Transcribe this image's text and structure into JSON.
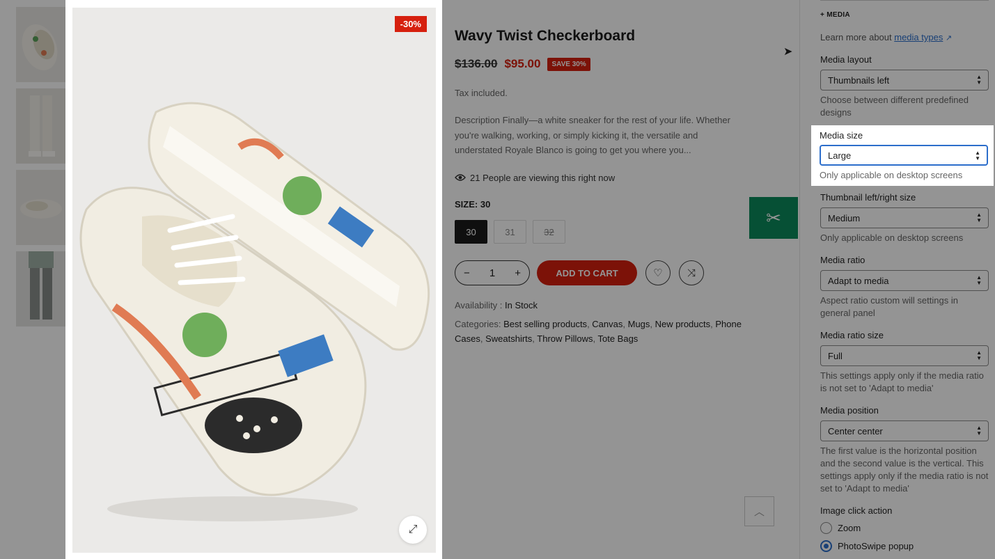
{
  "product": {
    "title": "Wavy Twist Checkerboard",
    "price_old": "$136.00",
    "price_new": "$95.00",
    "save_badge": "SAVE 30%",
    "sale_badge": "-30%",
    "tax_note": "Tax included.",
    "description": "Description Finally—a white sneaker for the rest of your life. Whether you're walking, working, or simply kicking it, the versatile and understated Royale Blanco is going to get you where you...",
    "viewing": "21 People are viewing this right now",
    "size_label": "SIZE: 30",
    "sizes": [
      "30",
      "31",
      "32"
    ],
    "quantity": "1",
    "add_to_cart": "ADD TO CART",
    "availability_label": "Availability :",
    "availability_value": "In Stock",
    "categories_label": "Categories:",
    "categories": [
      "Best selling products",
      "Canvas",
      "Mugs",
      "New products",
      "Phone Cases",
      "Sweatshirts",
      "Throw Pillows",
      "Tote Bags"
    ]
  },
  "panel": {
    "heading": "+ MEDIA",
    "learn_prefix": "Learn more about",
    "learn_link": "media types",
    "media_layout": {
      "label": "Media layout",
      "value": "Thumbnails left",
      "hint": "Choose between different predefined designs"
    },
    "media_size": {
      "label": "Media size",
      "value": "Large",
      "hint": "Only applicable on desktop screens"
    },
    "thumb_size": {
      "label": "Thumbnail left/right size",
      "value": "Medium",
      "hint": "Only applicable on desktop screens"
    },
    "media_ratio": {
      "label": "Media ratio",
      "value": "Adapt to media",
      "hint": "Aspect ratio custom will settings in general panel"
    },
    "media_ratio_size": {
      "label": "Media ratio size",
      "value": "Full",
      "hint": "This settings apply only if the media ratio is not set to 'Adapt to media'"
    },
    "media_position": {
      "label": "Media position",
      "value": "Center center",
      "hint": "The first value is the horizontal position and the second value is the vertical. This settings apply only if the media ratio is not set to 'Adapt to media'"
    },
    "image_click": {
      "label": "Image click action",
      "options": [
        "Zoom",
        "PhotoSwipe popup"
      ],
      "selected": "PhotoSwipe popup"
    }
  },
  "colors": {
    "accent": "#2c6ecb",
    "sale": "#d6200e",
    "tool": "#0b8a5c"
  },
  "icons": [
    "eye-icon",
    "expand-icon",
    "heart-icon",
    "compare-icon",
    "chevron-up-icon",
    "wrench-icon",
    "external-link-icon"
  ]
}
